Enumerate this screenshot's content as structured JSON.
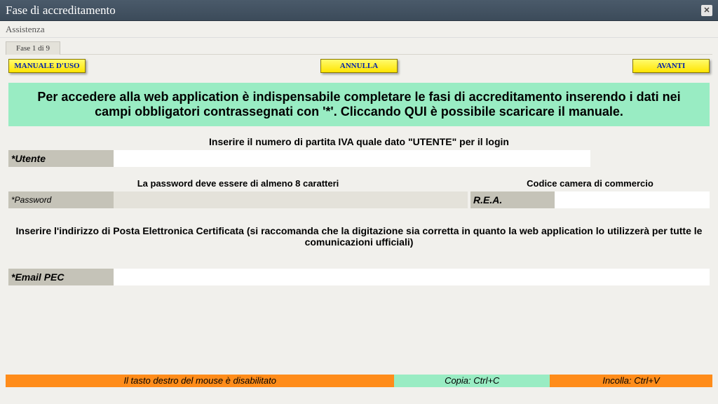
{
  "window": {
    "title": "Fase di accreditamento"
  },
  "menu": {
    "assistenza": "Assistenza"
  },
  "step_tab": "Fase 1 di 9",
  "buttons": {
    "manual": "MANUALE D'USO",
    "cancel": "ANNULLA",
    "next": "AVANTI"
  },
  "greenbox": "Per accedere alla web application è indispensabile completare le fasi di accreditamento inserendo i dati nei campi obbligatori contrassegnati con '*'. Cliccando QUI è possibile scaricare il manuale.",
  "instr_utente": "Inserire il numero di partita IVA quale dato \"UTENTE\" per il login",
  "labels": {
    "utente": "*Utente",
    "password": "*Password",
    "rea": "R.E.A.",
    "email_pec": "*Email PEC"
  },
  "instr_password": "La password deve essere di almeno 8 caratteri",
  "instr_rea": "Codice camera di commercio",
  "instr_pec": "Inserire l'indirizzo di Posta Elettronica Certificata (si raccomanda che la digitazione sia corretta in quanto la web application lo utilizzerà per tutte le comunicazioni ufficiali)",
  "footer": {
    "rclick": "Il tasto destro del mouse è disabilitato",
    "copy": "Copia: Ctrl+C",
    "paste": "Incolla: Ctrl+V"
  }
}
